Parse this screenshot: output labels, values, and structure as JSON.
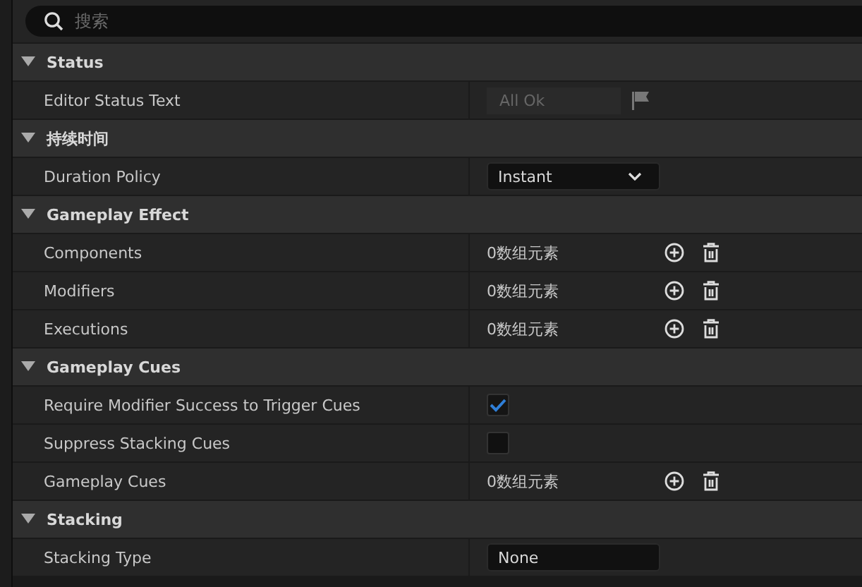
{
  "search": {
    "placeholder": "搜索"
  },
  "sections": [
    {
      "title": "Status",
      "expanded": true,
      "rows": [
        {
          "kind": "readonly",
          "label": "Editor Status Text",
          "value": "All Ok"
        }
      ]
    },
    {
      "title": "持续时间",
      "expanded": true,
      "rows": [
        {
          "kind": "dropdown",
          "label": "Duration Policy",
          "value": "Instant"
        }
      ]
    },
    {
      "title": "Gameplay Effect",
      "expanded": true,
      "rows": [
        {
          "kind": "array",
          "label": "Components",
          "value": "0数组元素"
        },
        {
          "kind": "array",
          "label": "Modifiers",
          "value": "0数组元素"
        },
        {
          "kind": "array",
          "label": "Executions",
          "value": "0数组元素"
        }
      ]
    },
    {
      "title": "Gameplay Cues",
      "expanded": true,
      "rows": [
        {
          "kind": "checkbox",
          "label": "Require Modifier Success to Trigger Cues",
          "checked": true
        },
        {
          "kind": "checkbox",
          "label": "Suppress Stacking Cues",
          "checked": false
        },
        {
          "kind": "array",
          "label": "Gameplay Cues",
          "value": "0数组元素"
        }
      ]
    },
    {
      "title": "Stacking",
      "expanded": true,
      "rows": [
        {
          "kind": "dropdown-plain",
          "label": "Stacking Type",
          "value": "None"
        }
      ]
    }
  ]
}
